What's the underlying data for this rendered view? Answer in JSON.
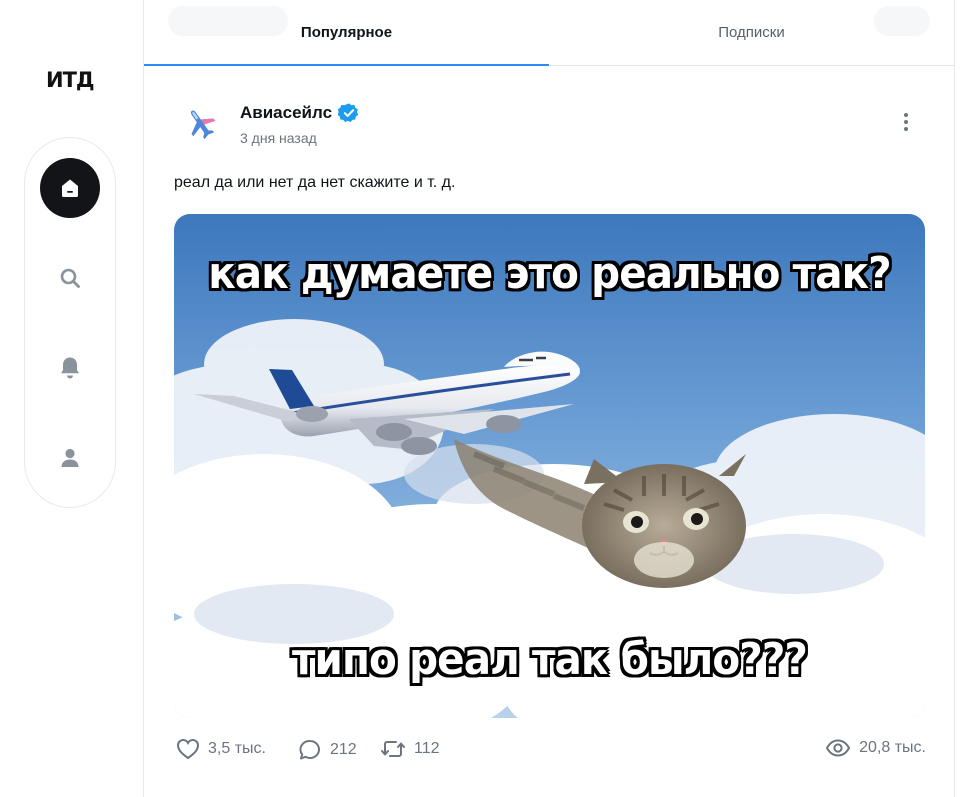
{
  "brand": {
    "logo_text": "ИТД"
  },
  "sidebar": {
    "items": [
      {
        "id": "home",
        "icon": "home-icon",
        "active": true
      },
      {
        "id": "search",
        "icon": "search-icon",
        "active": false
      },
      {
        "id": "notifications",
        "icon": "bell-icon",
        "active": false
      },
      {
        "id": "profile",
        "icon": "user-icon",
        "active": false
      }
    ]
  },
  "tabs": [
    {
      "label": "Популярное",
      "active": true
    },
    {
      "label": "Подписки",
      "active": false
    }
  ],
  "post": {
    "author": "Авиасейлс",
    "verified": true,
    "avatar_icon": "airplane-icon",
    "time": "3 дня назад",
    "text": "реал да или нет да нет скажите и т. д.",
    "image": {
      "caption_top": "как думаете это реально так?",
      "caption_bottom": "типо реал так было???",
      "depicts": "airplane-and-cat-in-clouds"
    },
    "stats": {
      "likes": "3,5 тыс.",
      "comments": "212",
      "reposts": "112",
      "views": "20,8 тыс."
    }
  },
  "colors": {
    "accent": "#2f8cf3",
    "active_nav": "#131417",
    "muted_text": "#6b7580",
    "verified": "#1d9bf0"
  }
}
